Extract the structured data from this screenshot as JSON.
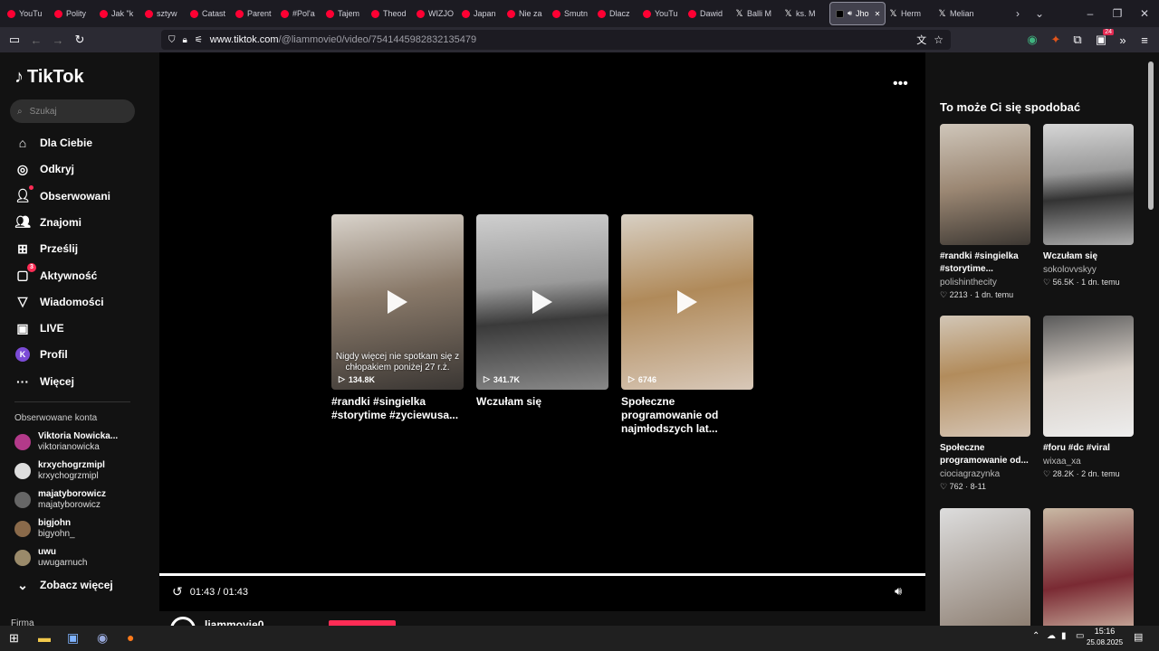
{
  "browser": {
    "tabs": [
      {
        "label": "YouTu",
        "fav": "yt"
      },
      {
        "label": "Polity",
        "fav": "yt"
      },
      {
        "label": "Jak \"k",
        "fav": "yt"
      },
      {
        "label": "sztyw",
        "fav": "yt"
      },
      {
        "label": "Catast",
        "fav": "yt"
      },
      {
        "label": "Parent",
        "fav": "yt"
      },
      {
        "label": "#Pol'a",
        "fav": "yt"
      },
      {
        "label": "Tajem",
        "fav": "yt"
      },
      {
        "label": "Theod",
        "fav": "yt"
      },
      {
        "label": "WIZJO",
        "fav": "yt"
      },
      {
        "label": "Japan",
        "fav": "yt"
      },
      {
        "label": "Nie za",
        "fav": "yt"
      },
      {
        "label": "Smutn",
        "fav": "yt"
      },
      {
        "label": "Dlacz",
        "fav": "yt"
      },
      {
        "label": "YouTu",
        "fav": "yt"
      },
      {
        "label": "Dawid",
        "fav": "yt"
      },
      {
        "label": "Balli M",
        "fav": "x"
      },
      {
        "label": "ks. M",
        "fav": "x"
      },
      {
        "label": "Jho",
        "fav": "tt",
        "active": true
      },
      {
        "label": "Herm",
        "fav": "x"
      },
      {
        "label": "Melian",
        "fav": "x"
      }
    ],
    "url_host": "www.tiktok.com",
    "url_path": "/@liammovie0/video/7541445982832135479",
    "ext_badge": "24"
  },
  "sidebar": {
    "logo": "TikTok",
    "search_placeholder": "Szukaj",
    "nav": [
      {
        "label": "Dla Ciebie",
        "icon": "home-icon"
      },
      {
        "label": "Odkryj",
        "icon": "compass-icon"
      },
      {
        "label": "Obserwowani",
        "icon": "following-icon"
      },
      {
        "label": "Znajomi",
        "icon": "friends-icon"
      },
      {
        "label": "Prześlij",
        "icon": "upload-icon"
      },
      {
        "label": "Aktywność",
        "icon": "activity-icon",
        "badge": "3"
      },
      {
        "label": "Wiadomości",
        "icon": "messages-icon"
      },
      {
        "label": "LIVE",
        "icon": "live-icon"
      },
      {
        "label": "Profil",
        "icon": "profile-avatar",
        "avatar": "K"
      },
      {
        "label": "Więcej",
        "icon": "more-icon"
      }
    ],
    "followed_title": "Obserwowane konta",
    "accounts": [
      {
        "name": "Viktoria Nowicka...",
        "handle": "viktorianowicka"
      },
      {
        "name": "krxychogrzmipl",
        "handle": "krxychogrzmipl"
      },
      {
        "name": "majatyborowicz",
        "handle": "majatyborowicz"
      },
      {
        "name": "bigjohn",
        "handle": "bigyohn_"
      },
      {
        "name": "uwu",
        "handle": "uwugarnuch"
      }
    ],
    "see_more": "Zobacz więcej",
    "footer": "Firma"
  },
  "main": {
    "cards": [
      {
        "views": "134.8K",
        "title": "#randki #singielka #storytime #zyciewusa...",
        "overlay": "Nigdy więcej nie spotkam się z chłopakiem poniżej 27 r.ż."
      },
      {
        "views": "341.7K",
        "title": "Wczułam się",
        "overlay": ""
      },
      {
        "views": "6746",
        "title": "Społeczne programowanie od najmłodszych lat...",
        "overlay": ""
      }
    ],
    "time": "01:43 / 01:43",
    "author": "liammovie0"
  },
  "right": {
    "title": "To może Ci się spodobać",
    "avatar": "K",
    "items": [
      {
        "caption": "#randki #singielka #storytime...",
        "author": "polishinthecity",
        "likes": "2213",
        "age": "1 dn. temu"
      },
      {
        "caption": "Wczułam się",
        "author": "sokolovvskyy",
        "likes": "56.5K",
        "age": "1 dn. temu"
      },
      {
        "caption": "Społeczne programowanie od...",
        "author": "ciociagrazynka",
        "likes": "762",
        "age": "8-11"
      },
      {
        "caption": "#foru #dc #viral",
        "author": "wixaa_xa",
        "likes": "28.2K",
        "age": "2 dn. temu"
      }
    ]
  },
  "taskbar": {
    "time": "15:16",
    "date": "25.08.2025"
  }
}
